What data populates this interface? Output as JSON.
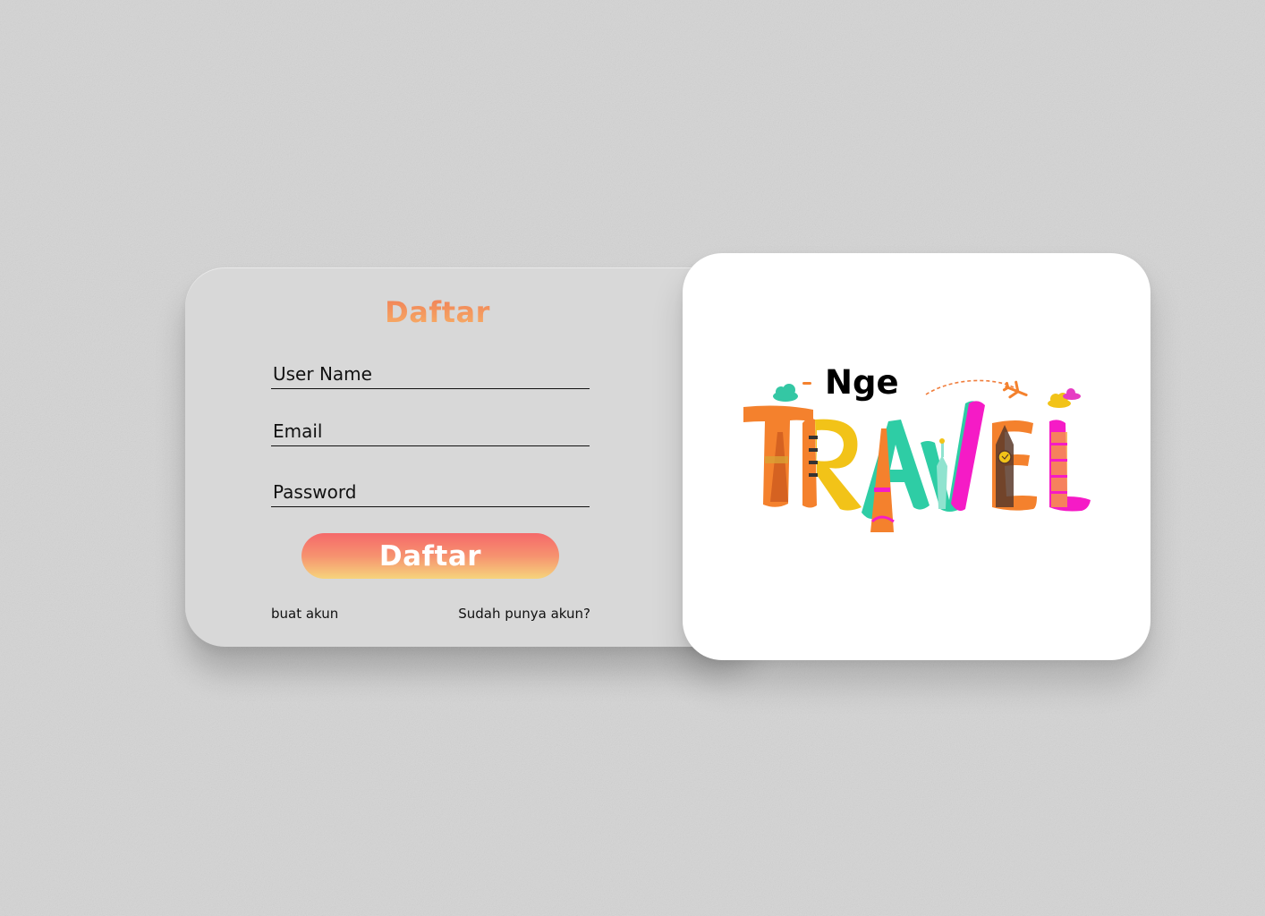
{
  "form": {
    "title": "Daftar",
    "fields": {
      "username_placeholder": "User Name",
      "email_placeholder": "Email",
      "password_placeholder": "Password"
    },
    "submit_label": "Daftar",
    "links": {
      "create_account": "buat akun",
      "have_account": "Sudah punya akun?"
    }
  },
  "logo": {
    "prefix": "Nge",
    "word": "TRAVEL"
  },
  "colors": {
    "title_gradient": [
      "#f07e55",
      "#f7b067"
    ],
    "button_gradient": [
      "#f5696a",
      "#f6926f",
      "#f6d47c"
    ],
    "logo_letters": [
      "#f4812d",
      "#f4812d",
      "#f2c318",
      "#2ecda5",
      "#f51bc6",
      "#f4812d",
      "#f51bc6"
    ]
  },
  "icons": [
    "cloud-icon",
    "airplane-icon",
    "eiffel-tower-icon",
    "statue-of-liberty-icon",
    "big-ben-icon",
    "pagoda-icon",
    "leaning-tower-icon"
  ]
}
